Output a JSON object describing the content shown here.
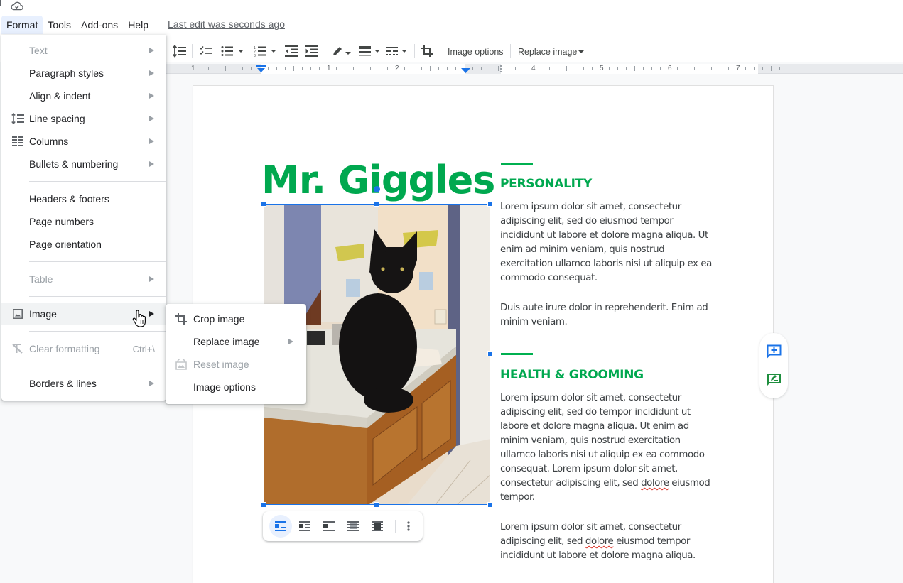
{
  "menubar": {
    "items": [
      {
        "label": "Format",
        "active": true
      },
      {
        "label": "Tools"
      },
      {
        "label": "Add-ons"
      },
      {
        "label": "Help"
      }
    ],
    "last_edit": "Last edit was seconds ago",
    "cloud_icon": "cloud-saved-icon"
  },
  "toolbar": {
    "icons": [
      "line-spacing-icon",
      "checklist-icon",
      "bulleted-list-icon",
      "numbered-list-icon",
      "decrease-indent-icon",
      "increase-indent-icon",
      "border-color-icon",
      "border-weight-icon",
      "border-dash-icon",
      "crop-icon"
    ],
    "image_options": "Image options",
    "replace_image": "Replace image"
  },
  "ruler": {
    "labels": [
      "1",
      "1",
      "2",
      "4",
      "5",
      "6",
      "7"
    ]
  },
  "format_menu": {
    "items": [
      {
        "label": "Text",
        "disabled": true,
        "submenu": true
      },
      {
        "label": "Paragraph styles",
        "submenu": true
      },
      {
        "label": "Align & indent",
        "submenu": true
      },
      {
        "label": "Line spacing",
        "submenu": true,
        "icon": "line-spacing-icon"
      },
      {
        "label": "Columns",
        "submenu": true,
        "icon": "columns-icon"
      },
      {
        "label": "Bullets & numbering",
        "submenu": true
      },
      {
        "label": "Headers & footers"
      },
      {
        "label": "Page numbers"
      },
      {
        "label": "Page orientation"
      },
      {
        "label": "Table",
        "disabled": true,
        "submenu": true
      },
      {
        "label": "Image",
        "submenu": true,
        "icon": "image-icon",
        "hovered": true
      },
      {
        "label": "Clear formatting",
        "disabled": true,
        "shortcut": "Ctrl+\\",
        "icon": "clear-formatting-icon"
      },
      {
        "label": "Borders & lines",
        "submenu": true
      }
    ]
  },
  "image_submenu": {
    "items": [
      {
        "label": "Crop image",
        "icon": "crop-icon"
      },
      {
        "label": "Replace image",
        "submenu": true
      },
      {
        "label": "Reset image",
        "disabled": true,
        "icon": "reset-image-icon"
      },
      {
        "label": "Image options"
      }
    ]
  },
  "document": {
    "title": "Mr. Giggles",
    "image_alt": "Black cat sitting on a bathroom vanity countertop",
    "sections": [
      {
        "heading": "PERSONALITY",
        "paragraphs": [
          "Lorem ipsum dolor sit amet, consectetur adipiscing elit, sed do eiusmod tempor incididunt ut labore et dolore magna aliqua. Ut enim ad minim veniam, quis nostrud exercitation ullamco laboris nisi ut aliquip ex ea commodo consequat.",
          "Duis aute irure dolor in reprehenderit. Enim ad minim veniam."
        ]
      },
      {
        "heading": "HEALTH & GROOMING",
        "paragraphs": [
          {
            "before": "Lorem ipsum dolor sit amet, consectetur adipiscing elit, sed do tempor incididunt ut labore et dolore magna aliqua. Ut enim ad minim veniam, quis nostrud exercitation ullamco laboris nisi ut aliquip ex ea commodo consequat. Lorem ipsum dolor sit amet, consectetur adipiscing elit, sed ",
            "misspelled": "dolore",
            "after": " eiusmod tempor."
          },
          {
            "before": "Lorem ipsum dolor sit amet, consectetur adipiscing elit, sed ",
            "misspelled": "dolore",
            "after": " eiusmod tempor incididunt ut labore et dolore magna aliqua."
          }
        ]
      }
    ]
  },
  "wrap_toolbar": {
    "options": [
      "inline-icon",
      "wrap-text-icon",
      "break-text-icon",
      "behind-text-icon",
      "in-front-of-text-icon",
      "more-options-icon"
    ],
    "selected": "inline-icon"
  },
  "side_actions": [
    "add-comment-icon",
    "suggest-edits-icon"
  ],
  "colors": {
    "accent_blue": "#1a73e8",
    "title_green": "#00a84f"
  }
}
